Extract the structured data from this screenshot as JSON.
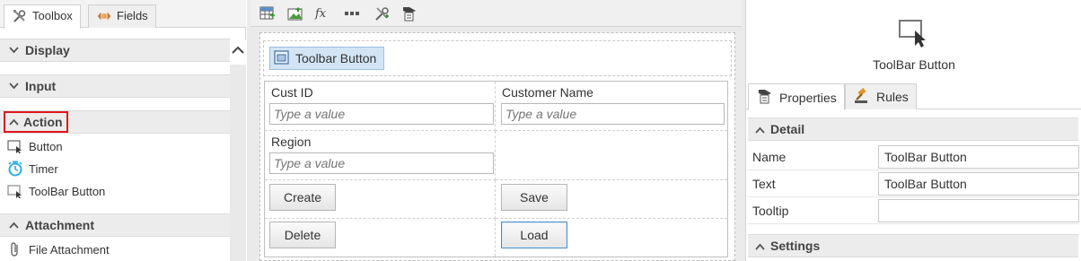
{
  "left": {
    "tabs": [
      {
        "label": "Toolbox",
        "icon": "wrench-screwdriver-icon",
        "active": true
      },
      {
        "label": "Fields",
        "icon": "fields-icon",
        "active": false
      }
    ],
    "sections": [
      {
        "label": "Display",
        "expanded": false
      },
      {
        "label": "Input",
        "expanded": false
      },
      {
        "label": "Action",
        "expanded": true,
        "highlighted": true,
        "items": [
          {
            "label": "Button",
            "icon": "button-cursor-icon"
          },
          {
            "label": "Timer",
            "icon": "stopwatch-icon"
          },
          {
            "label": "ToolBar Button",
            "icon": "toolbar-button-icon"
          }
        ]
      },
      {
        "label": "Attachment",
        "expanded": true,
        "items": [
          {
            "label": "File Attachment",
            "icon": "paperclip-icon"
          }
        ]
      }
    ]
  },
  "toolbar": {
    "buttons": [
      "table-icon",
      "image-upload-icon",
      "function-fx-icon",
      "ellipsis-icon",
      "tools-icon",
      "properties-icon"
    ]
  },
  "canvas": {
    "toolbar_button_label": "Toolbar Button",
    "fields": {
      "cust_id_label": "Cust ID",
      "cust_id_placeholder": "Type a value",
      "customer_name_label": "Customer Name",
      "customer_name_placeholder": "Type a value",
      "region_label": "Region",
      "region_placeholder": "Type a value"
    },
    "buttons": {
      "create": "Create",
      "save": "Save",
      "delete": "Delete",
      "load": "Load"
    }
  },
  "right": {
    "title": "ToolBar Button",
    "tabs": [
      {
        "label": "Properties",
        "icon": "properties-icon",
        "active": true
      },
      {
        "label": "Rules",
        "icon": "gavel-icon",
        "active": false
      }
    ],
    "detail_label": "Detail",
    "properties": [
      {
        "name": "Name",
        "value": "ToolBar Button"
      },
      {
        "name": "Text",
        "value": "ToolBar Button"
      },
      {
        "name": "Tooltip",
        "value": ""
      }
    ],
    "settings_label": "Settings"
  },
  "colors": {
    "highlight": "#e0161b",
    "selection": "#d3e5f5",
    "timer_icon": "#2eaee0"
  }
}
